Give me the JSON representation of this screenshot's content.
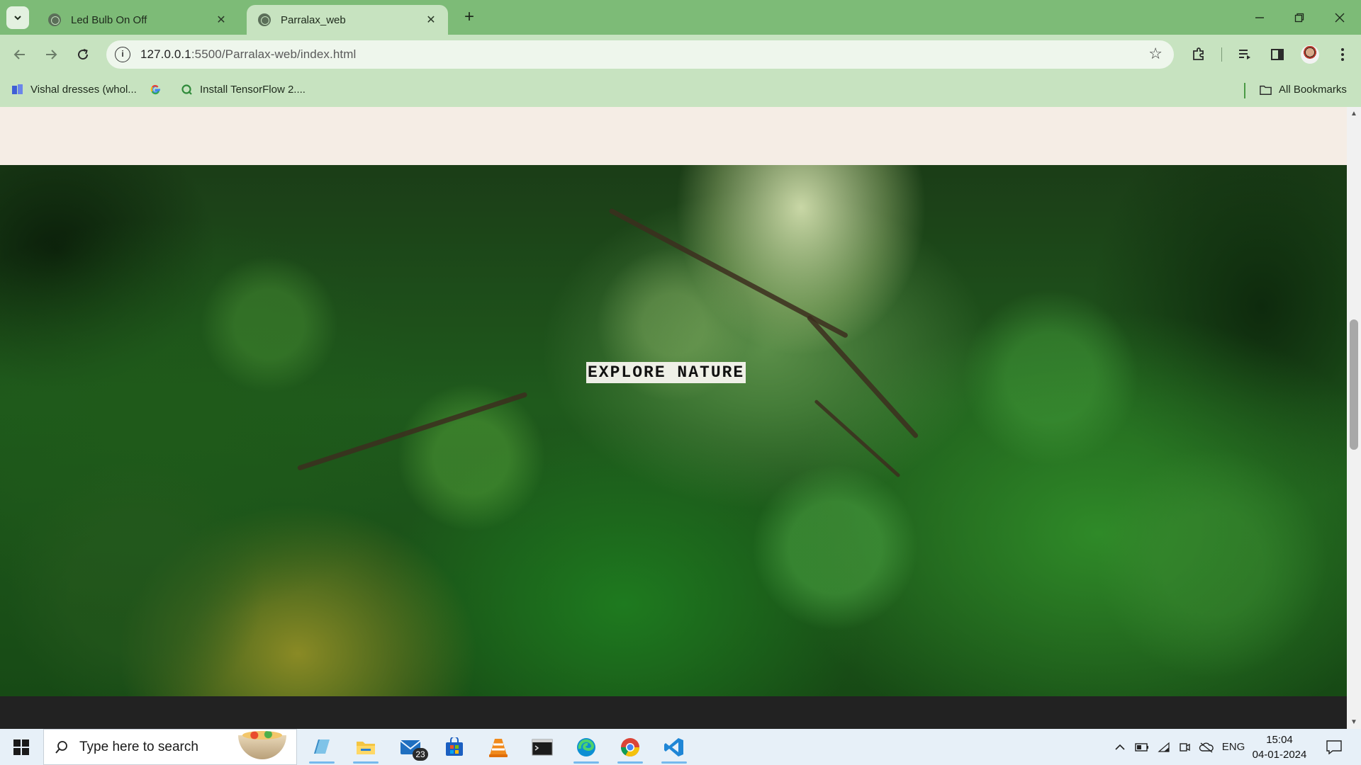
{
  "browser": {
    "tabs": [
      {
        "title": "Led Bulb On Off",
        "active": false
      },
      {
        "title": "Parralax_web",
        "active": true
      }
    ],
    "address": {
      "host": "127.0.0.1",
      "rest": ":5500/Parralax-web/index.html"
    },
    "bookmarks": [
      {
        "label": "Vishal dresses (whol...",
        "icon": "puzzle-app-icon"
      },
      {
        "label": "",
        "icon": "google-icon"
      },
      {
        "label": "Install TensorFlow 2....",
        "icon": "search-q-icon"
      }
    ],
    "all_bookmarks_label": "All Bookmarks"
  },
  "page": {
    "hero_text": "EXPLORE NATURE"
  },
  "taskbar": {
    "search_placeholder": "Type here to search",
    "mail_badge": "23",
    "language": "ENG",
    "time": "15:04",
    "date": "04-01-2024"
  },
  "colors": {
    "tab_strip": "#7dbb77",
    "toolbar": "#c7e3c0",
    "page_bg": "#f5ede5",
    "footer_band": "#222222"
  }
}
